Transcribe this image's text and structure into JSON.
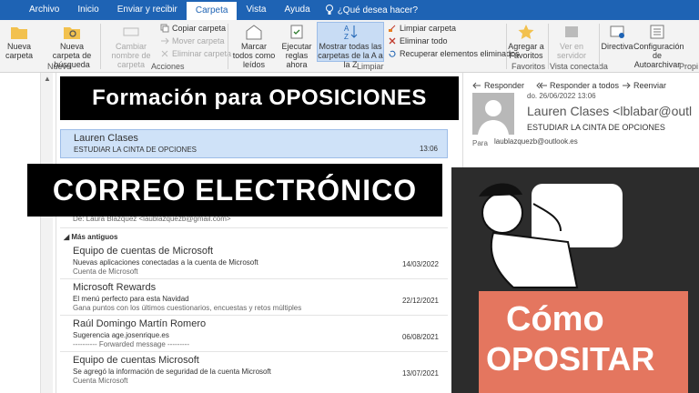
{
  "ribbon_tabs": [
    "Archivo",
    "Inicio",
    "Enviar y recibir",
    "Carpeta",
    "Vista",
    "Ayuda"
  ],
  "active_tab": "Carpeta",
  "tell_me": "¿Qué desea hacer?",
  "ribbon": {
    "new_folder": "Nueva carpeta",
    "new_search_folder": "Nueva carpeta de búsqueda",
    "group_nuevo": "Nuevo",
    "rename_folder": "Cambiar nombre de carpeta",
    "copy_folder": "Copiar carpeta",
    "move_folder": "Mover carpeta",
    "delete_folder": "Eliminar carpeta",
    "group_acciones": "Acciones",
    "mark_all_read": "Marcar todos como leídos",
    "run_rules": "Ejecutar reglas ahora",
    "show_all_folders": "Mostrar todas las carpetas de la A a la Z",
    "clean_folder": "Limpiar carpeta",
    "delete_all": "Eliminar todo",
    "recover_items": "Recuperar elementos eliminados",
    "group_limpiar": "Limpiar",
    "add_favorites": "Agregar a Favoritos",
    "group_favoritos": "Favoritos",
    "view_on_server": "Ver en servidor",
    "group_vista_conectada": "Vista conectada",
    "policy": "Directiva",
    "autoarchive": "Configuración de Autoarchivar",
    "group_propiedades": "Propi"
  },
  "messages": [
    {
      "from": "Lauren Clases",
      "subject": "ESTUDIAR LA CINTA DE OPCIONES",
      "date": "13:06",
      "selected": true
    },
    {
      "from": "Equipo de cuentas de Microsoft",
      "subject": "Nuevas aplicaciones conectadas a la cuenta de Microsoft",
      "preview": "Cuenta de Microsoft",
      "date": "14/03/2022"
    },
    {
      "from": "Microsoft Rewards",
      "subject": "El menú perfecto para esta Navidad",
      "preview": "Gana puntos con los últimos cuestionarios, encuestas y retos múltiples",
      "date": "22/12/2021"
    },
    {
      "from": "Raúl Domingo Martín Romero",
      "subject": "Sugerencia age.josenrique.es",
      "preview": "---------- Forwarded message ---------",
      "date": "06/08/2021"
    },
    {
      "from": "Equipo de cuentas Microsoft",
      "subject": "Se agregó la información de seguridad de la cuenta Microsoft",
      "preview": "Cuenta Microsoft",
      "date": "13/07/2021"
    }
  ],
  "partial_line": "De: Laura Blazquez <laublazquezb@gmail.com>",
  "group_older": "Más antiguos",
  "reading": {
    "reply": "Responder",
    "reply_all": "Responder a todos",
    "forward": "Reenviar",
    "date": "do. 26/06/2022 13:06",
    "from": "Lauren Clases <lblabar@outl",
    "subject": "ESTUDIAR LA CINTA DE OPCIONES",
    "to_label": "Para",
    "to": "laublazquezb@outlook.es"
  },
  "overlay": {
    "banner1": "Formación para OPOSICIONES",
    "banner2": "CORREO ELECTRÓNICO",
    "promo1": "Cómo",
    "promo2": "OPOSITAR"
  },
  "colors": {
    "ribbon_blue": "#1e63b4",
    "selected_row": "#cfe2f8",
    "promo_accent": "#e4765f"
  }
}
